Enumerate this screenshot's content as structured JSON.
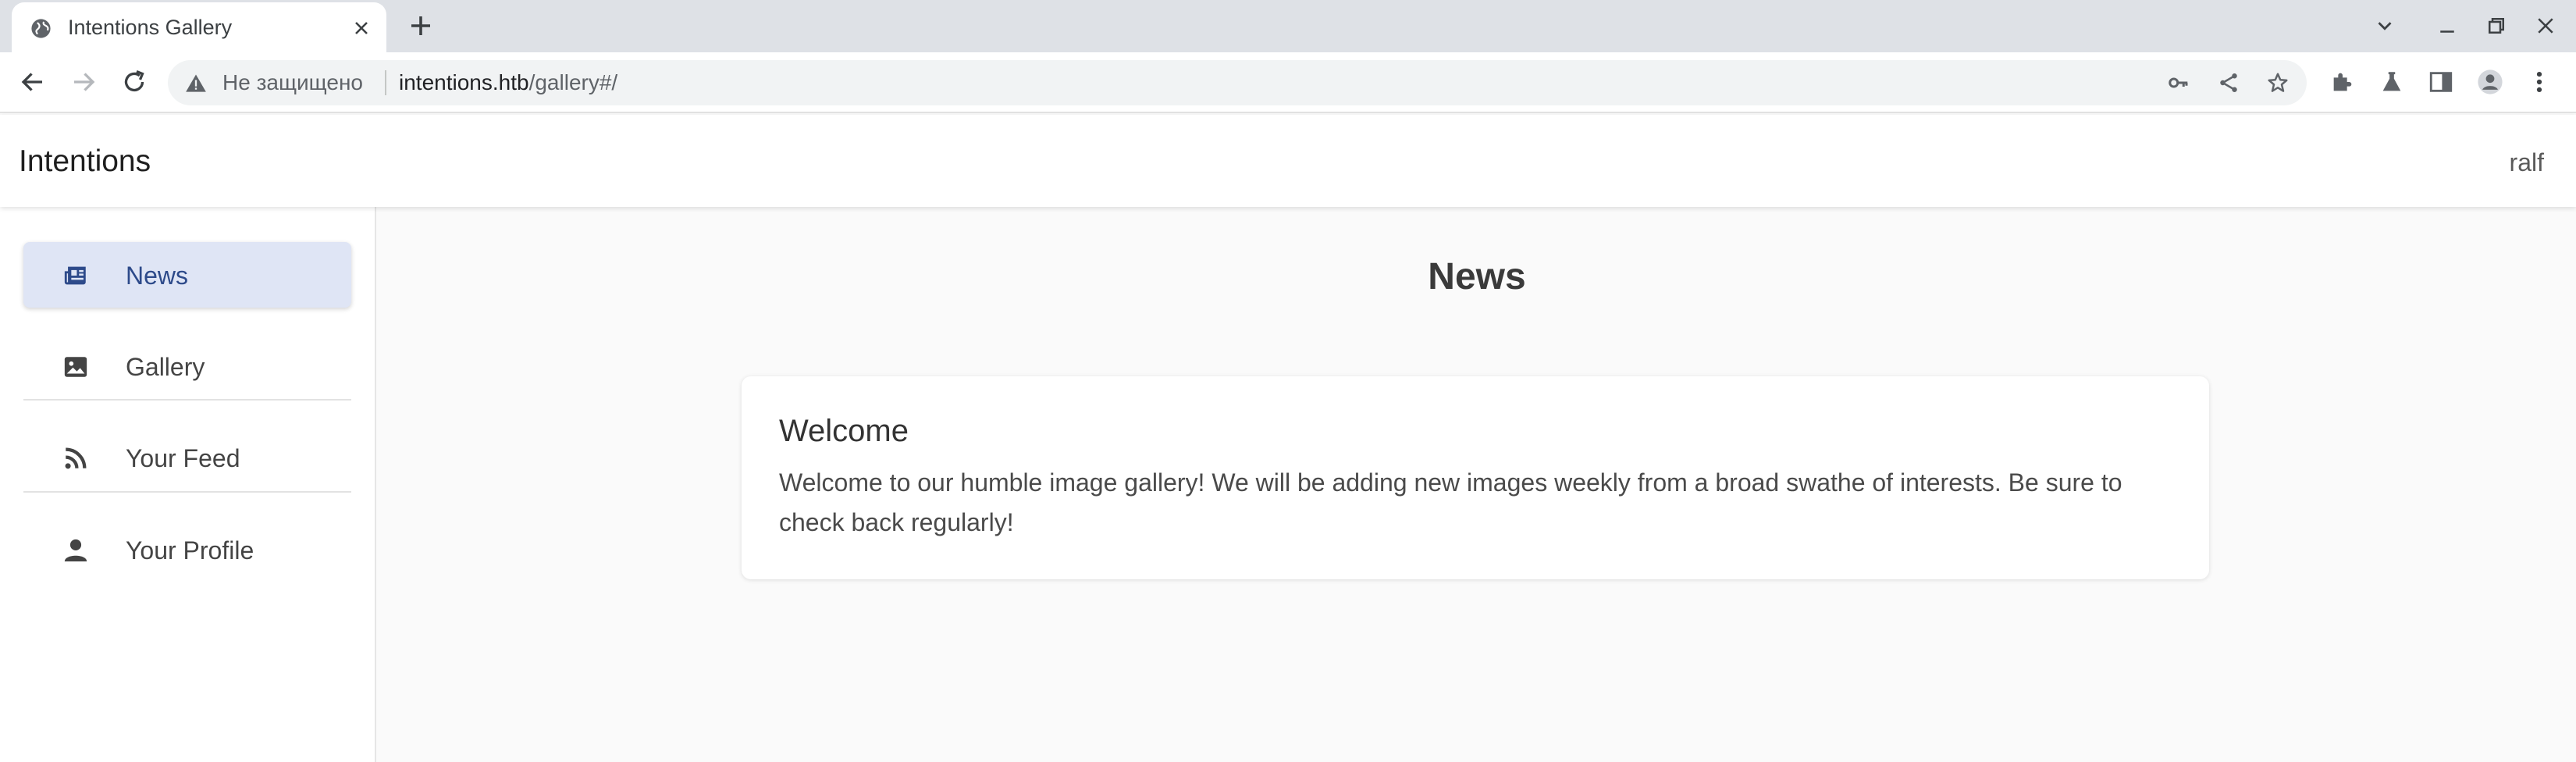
{
  "browser": {
    "tab_title": "Intentions Gallery",
    "security_label": "Не защищено",
    "url_host": "intentions.htb",
    "url_path": "/gallery#/"
  },
  "app": {
    "title": "Intentions",
    "user": "ralf"
  },
  "sidebar": {
    "items": [
      {
        "label": "News",
        "icon": "newspaper-icon",
        "active": true
      },
      {
        "label": "Gallery",
        "icon": "image-icon",
        "active": false
      },
      {
        "label": "Your Feed",
        "icon": "rss-icon",
        "active": false
      },
      {
        "label": "Your Profile",
        "icon": "person-icon",
        "active": false
      }
    ]
  },
  "main": {
    "heading": "News",
    "card": {
      "title": "Welcome",
      "body": "Welcome to our humble image gallery! We will be adding new images weekly from a broad swathe of interests. Be sure to check back regularly!"
    }
  },
  "colors": {
    "accent": "#2d4a8a",
    "active_bg": "#dfe5f5",
    "chrome_bg": "#dee1e6"
  }
}
